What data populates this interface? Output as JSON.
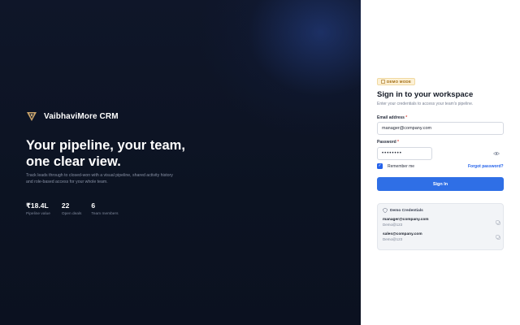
{
  "brand": {
    "name": "VaibhaviMore CRM",
    "logo_icon": "v-shield-logo",
    "accent": "#c9a36a"
  },
  "hero": {
    "headline": "Your pipeline, your team, one clear view.",
    "tagline": "Track leads through to closed-won with a visual pipeline, shared activity history and role-based access for your whole team.",
    "stats": [
      {
        "value": "₹18.4L",
        "label": "Pipeline value"
      },
      {
        "value": "22",
        "label": "Open deals"
      },
      {
        "value": "6",
        "label": "Team members"
      }
    ]
  },
  "form": {
    "badge": "DEMO MODE",
    "title": "Sign in to your workspace",
    "subtitle": "Enter your credentials to access your team's pipeline.",
    "email_label": "Email address",
    "email_value": "manager@company.com",
    "password_label": "Password",
    "password_value": "••••••••",
    "required_mark": "*",
    "remember_label": "Remember me",
    "remember_checked": true,
    "forgot_link": "Forgot password?",
    "submit_label": "Sign In",
    "primary_color": "#2f6fe6"
  },
  "credentials": {
    "title": "Demo Credentials",
    "items": [
      {
        "email": "manager@company.com",
        "password": "Demo@123"
      },
      {
        "email": "sales@company.com",
        "password": "Demo@123"
      }
    ]
  }
}
